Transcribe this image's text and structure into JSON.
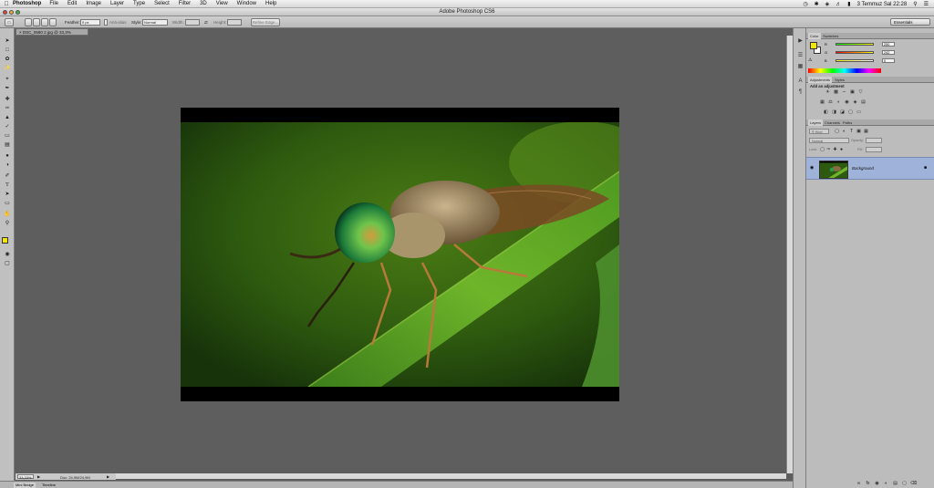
{
  "menubar": {
    "apple": "",
    "app_name": "Photoshop",
    "items": [
      "File",
      "Edit",
      "Image",
      "Layer",
      "Type",
      "Select",
      "Filter",
      "3D",
      "View",
      "Window",
      "Help"
    ],
    "clock": "3 Temmuz Sal 22:28"
  },
  "window": {
    "title": "Adobe Photoshop CS6"
  },
  "options": {
    "feather_label": "Feather:",
    "feather_value": "0 px",
    "antialias_label": "Anti-alias",
    "style_label": "Style:",
    "style_value": "Normal",
    "width_label": "Width:",
    "height_label": "Height:",
    "refine_edge": "Refine Edge...",
    "workspace": "Essentials"
  },
  "document": {
    "tab_label": "DSC_0580 2.jpg @ 33,3% (RGB/8*)",
    "zoom": "33,33%",
    "doc_info": "Doc: 24,9M/24,9M"
  },
  "bottom_tabs": [
    "Mini Bridge",
    "Timeline"
  ],
  "colors": {
    "foreground": "#f5e600",
    "background": "#ffffff",
    "selection": "#9fb2d9"
  },
  "color_panel": {
    "tabs": [
      "Color",
      "Swatches"
    ],
    "channels": [
      {
        "label": "R",
        "value": "250"
      },
      {
        "label": "G",
        "value": "242"
      },
      {
        "label": "B",
        "value": "0"
      }
    ]
  },
  "adjustments_panel": {
    "tabs": [
      "Adjustments",
      "Styles"
    ],
    "heading": "Add an adjustment"
  },
  "layers_panel": {
    "tabs": [
      "Layers",
      "Channels",
      "Paths"
    ],
    "kind_label": "Kind",
    "blend_mode": "Normal",
    "opacity_label": "Opacity:",
    "lock_label": "Lock:",
    "fill_label": "Fill:",
    "layers": [
      {
        "name": "Background",
        "locked": true,
        "visible": true
      }
    ]
  }
}
